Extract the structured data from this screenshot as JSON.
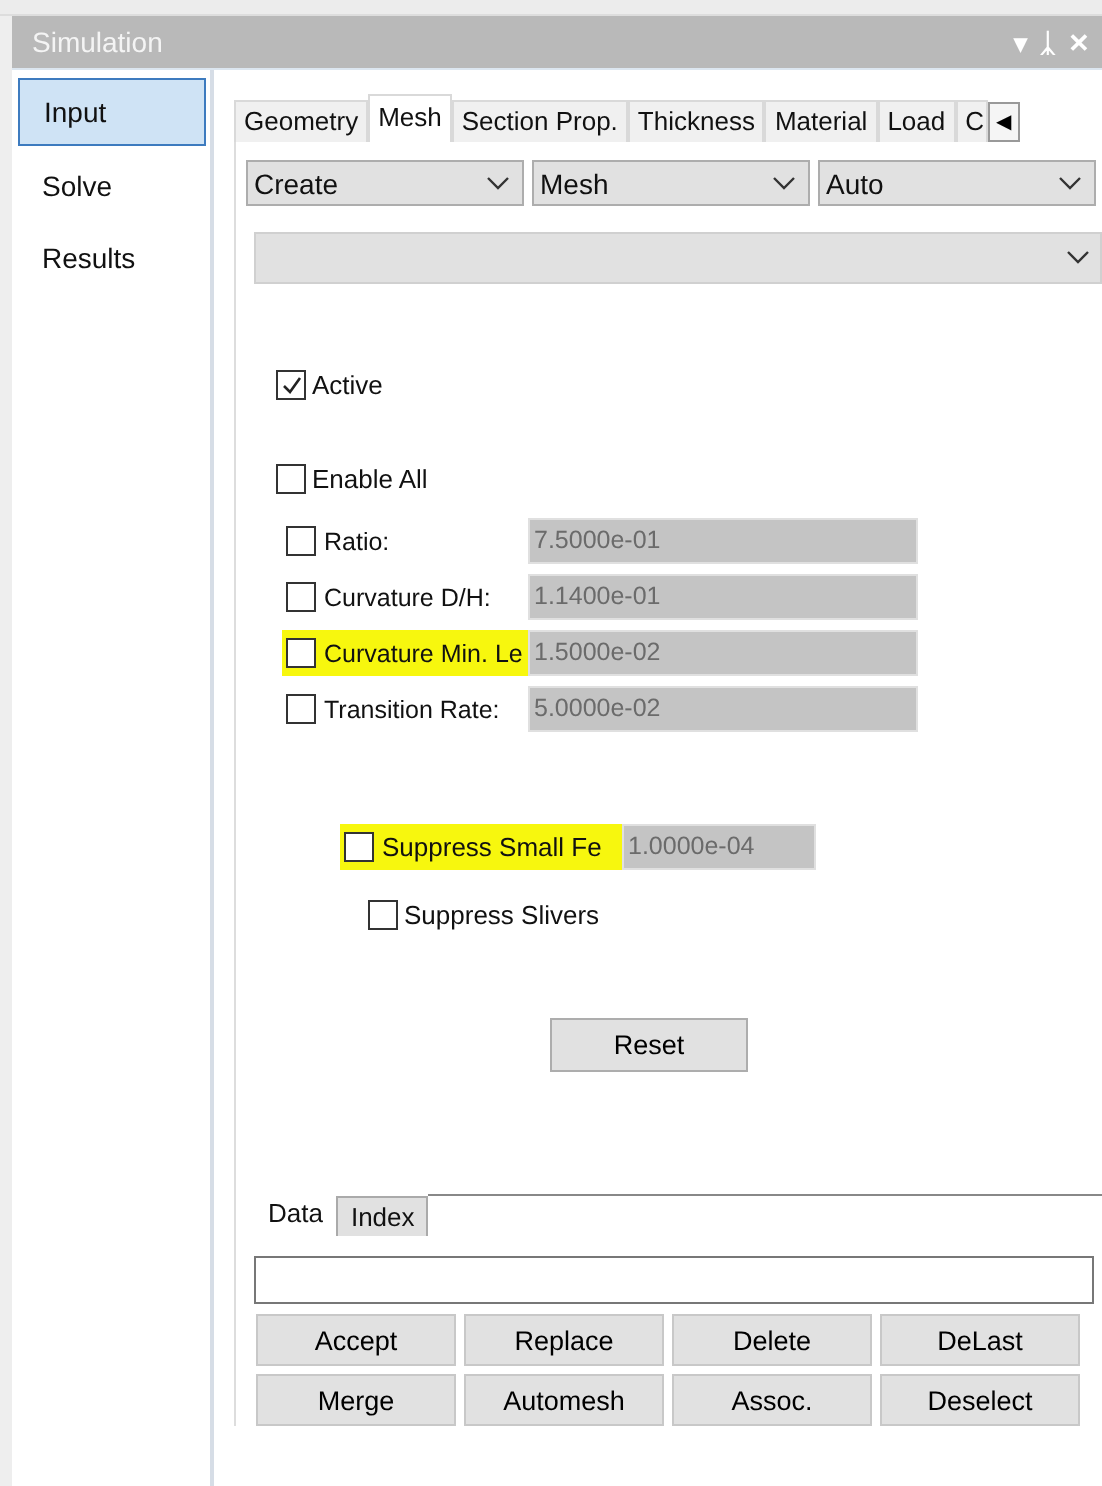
{
  "window": {
    "title": "Simulation",
    "controls": [
      "▾",
      "ᛣ",
      "✕"
    ]
  },
  "sidebar": {
    "items": [
      {
        "label": "Input",
        "selected": true
      },
      {
        "label": "Solve",
        "selected": false
      },
      {
        "label": "Results",
        "selected": false
      }
    ]
  },
  "tabs": [
    {
      "label": "Geometry",
      "selected": false
    },
    {
      "label": "Mesh",
      "selected": true
    },
    {
      "label": "Section Prop.",
      "selected": false
    },
    {
      "label": "Thickness",
      "selected": false
    },
    {
      "label": "Material",
      "selected": false
    },
    {
      "label": "Load",
      "selected": false
    },
    {
      "label": "C",
      "selected": false
    }
  ],
  "tab_scroll": "◀",
  "dropdowns": [
    {
      "value": "Create"
    },
    {
      "value": "Mesh"
    },
    {
      "value": "Auto"
    }
  ],
  "active": {
    "label": "Active",
    "checked": true
  },
  "enable_all": {
    "label": "Enable All",
    "checked": false
  },
  "parameters": [
    {
      "label": "Ratio:",
      "checked": false,
      "value": "7.5000e-01",
      "highlighted": false
    },
    {
      "label": "Curvature D/H:",
      "checked": false,
      "value": "1.1400e-01",
      "highlighted": false
    },
    {
      "label": "Curvature Min. Le",
      "checked": false,
      "value": "1.5000e-02",
      "highlighted": true
    },
    {
      "label": "Transition Rate:",
      "checked": false,
      "value": "5.0000e-02",
      "highlighted": false
    }
  ],
  "suppress_small": {
    "label": "Suppress Small Fe",
    "checked": false,
    "value": "1.0000e-04",
    "highlighted": true
  },
  "suppress_slivers": {
    "label": "Suppress Slivers",
    "checked": false
  },
  "reset_button": "Reset",
  "bottom_tabs": [
    {
      "label": "Data",
      "selected": true
    },
    {
      "label": "Index",
      "selected": false
    }
  ],
  "buttons": [
    [
      "Accept",
      "Replace",
      "Delete",
      "DeLast"
    ],
    [
      "Merge",
      "Automesh",
      "Assoc.",
      "Deselect"
    ]
  ]
}
